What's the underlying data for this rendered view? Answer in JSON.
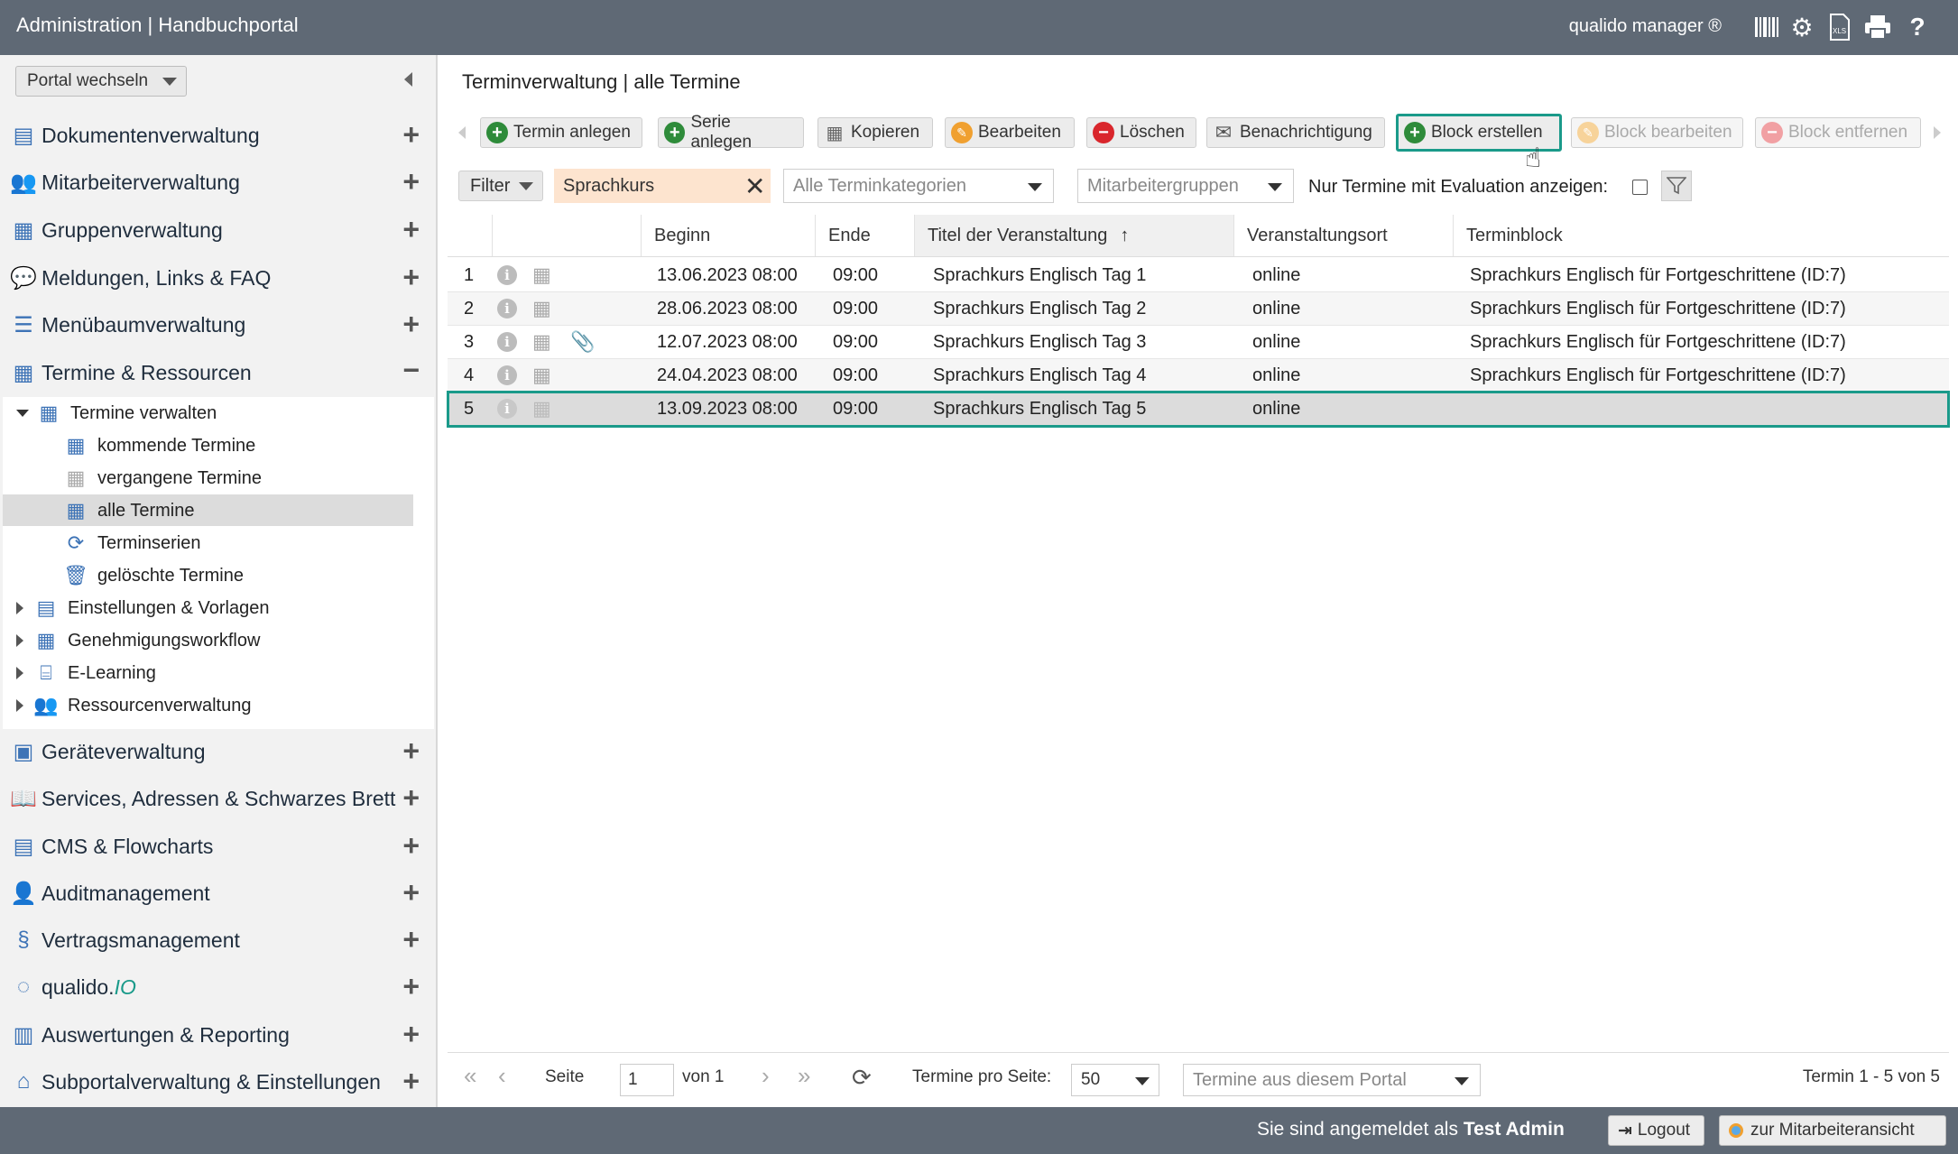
{
  "header": {
    "title": "Administration | Handbuchportal",
    "brand": "qualido manager ®",
    "icons": [
      "barcode-icon",
      "settings-gears-icon",
      "xlsx-export-icon",
      "print-icon",
      "help-icon"
    ]
  },
  "sidebar": {
    "portal_switch": "Portal wechseln",
    "modules_top": [
      {
        "label": "Dokumentenverwaltung",
        "icon": "documents-icon"
      },
      {
        "label": "Mitarbeiterverwaltung",
        "icon": "users-icon"
      },
      {
        "label": "Gruppenverwaltung",
        "icon": "group-icon"
      },
      {
        "label": "Meldungen, Links & FAQ",
        "icon": "chat-icon"
      },
      {
        "label": "Menübaumverwaltung",
        "icon": "menu-tree-icon"
      },
      {
        "label": "Termine & Ressourcen",
        "icon": "calendar-icon"
      }
    ],
    "tree": {
      "termine_verwalten": "Termine verwalten",
      "kommende": "kommende Termine",
      "vergangene": "vergangene Termine",
      "alle": "alle Termine",
      "serien": "Terminserien",
      "geloeschte": "gelöschte Termine",
      "einstellungen": "Einstellungen & Vorlagen",
      "workflow": "Genehmigungsworkflow",
      "elearning": "E-Learning",
      "ressourcen": "Ressourcenverwaltung"
    },
    "modules_bottom": [
      {
        "label": "Geräteverwaltung",
        "icon": "device-icon"
      },
      {
        "label": "Services, Adressen & Schwarzes Brett",
        "icon": "book-icon"
      },
      {
        "label": "CMS & Flowcharts",
        "icon": "cms-icon"
      },
      {
        "label": "Auditmanagement",
        "icon": "auditor-icon"
      },
      {
        "label": "Vertragsmanagement",
        "icon": "paragraph-icon"
      },
      {
        "label": "qualido.",
        "label_suffix": "IO",
        "icon": "qualido-io-icon"
      },
      {
        "label": "Auswertungen & Reporting",
        "icon": "bar-chart-icon"
      },
      {
        "label": "Subportalverwaltung & Einstellungen",
        "icon": "home-icon"
      }
    ]
  },
  "main": {
    "breadcrumb": "Terminverwaltung | alle Termine",
    "toolbar": {
      "termin_anlegen": "Termin anlegen",
      "serie_anlegen": "Serie anlegen",
      "kopieren": "Kopieren",
      "bearbeiten": "Bearbeiten",
      "loeschen": "Löschen",
      "benachrichtigung": "Benachrichtigung",
      "block_erstellen": "Block erstellen",
      "block_bearbeiten": "Block bearbeiten",
      "block_entfernen": "Block entfernen"
    },
    "filter": {
      "label": "Filter",
      "search_value": "Sprachkurs",
      "category_placeholder": "Alle Terminkategorien",
      "group_placeholder": "Mitarbeitergruppen",
      "evaluation_label": "Nur Termine mit Evaluation anzeigen:"
    },
    "columns": {
      "beginn": "Beginn",
      "ende": "Ende",
      "titel": "Titel der Veranstaltung",
      "ort": "Veranstaltungsort",
      "block": "Terminblock"
    },
    "rows": [
      {
        "n": "1",
        "beginn": "13.06.2023 08:00",
        "ende": "09:00",
        "titel": "Sprachkurs Englisch Tag 1",
        "ort": "online",
        "block": "Sprachkurs Englisch für Fortgeschrittene (ID:7)"
      },
      {
        "n": "2",
        "beginn": "28.06.2023 08:00",
        "ende": "09:00",
        "titel": "Sprachkurs Englisch Tag 2",
        "ort": "online",
        "block": "Sprachkurs Englisch für Fortgeschrittene (ID:7)"
      },
      {
        "n": "3",
        "beginn": "12.07.2023 08:00",
        "ende": "09:00",
        "titel": "Sprachkurs Englisch Tag 3",
        "ort": "online",
        "block": "Sprachkurs Englisch für Fortgeschrittene (ID:7)"
      },
      {
        "n": "4",
        "beginn": "24.04.2023 08:00",
        "ende": "09:00",
        "titel": "Sprachkurs Englisch Tag 4",
        "ort": "online",
        "block": "Sprachkurs Englisch für Fortgeschrittene (ID:7)"
      },
      {
        "n": "5",
        "beginn": "13.09.2023 08:00",
        "ende": "09:00",
        "titel": "Sprachkurs Englisch Tag 5",
        "ort": "online",
        "block": ""
      }
    ],
    "pager": {
      "seite": "Seite",
      "page_value": "1",
      "von": "von 1",
      "per_page_label": "Termine pro Seite:",
      "per_page_value": "50",
      "portal_filter": "Termine aus diesem Portal",
      "summary": "Termin 1 - 5 von 5"
    }
  },
  "footer": {
    "logged_in_prefix": "Sie sind angemeldet als",
    "user": "Test Admin",
    "logout": "Logout",
    "employee_view": "zur Mitarbeiteransicht"
  },
  "colors": {
    "header_bg": "#5f6975",
    "accent_teal": "#1a9a8a",
    "icon_blue": "#3d73b6",
    "green_add": "#2e8b3a",
    "red_delete": "#d9262c",
    "orange_edit": "#f0a030"
  }
}
